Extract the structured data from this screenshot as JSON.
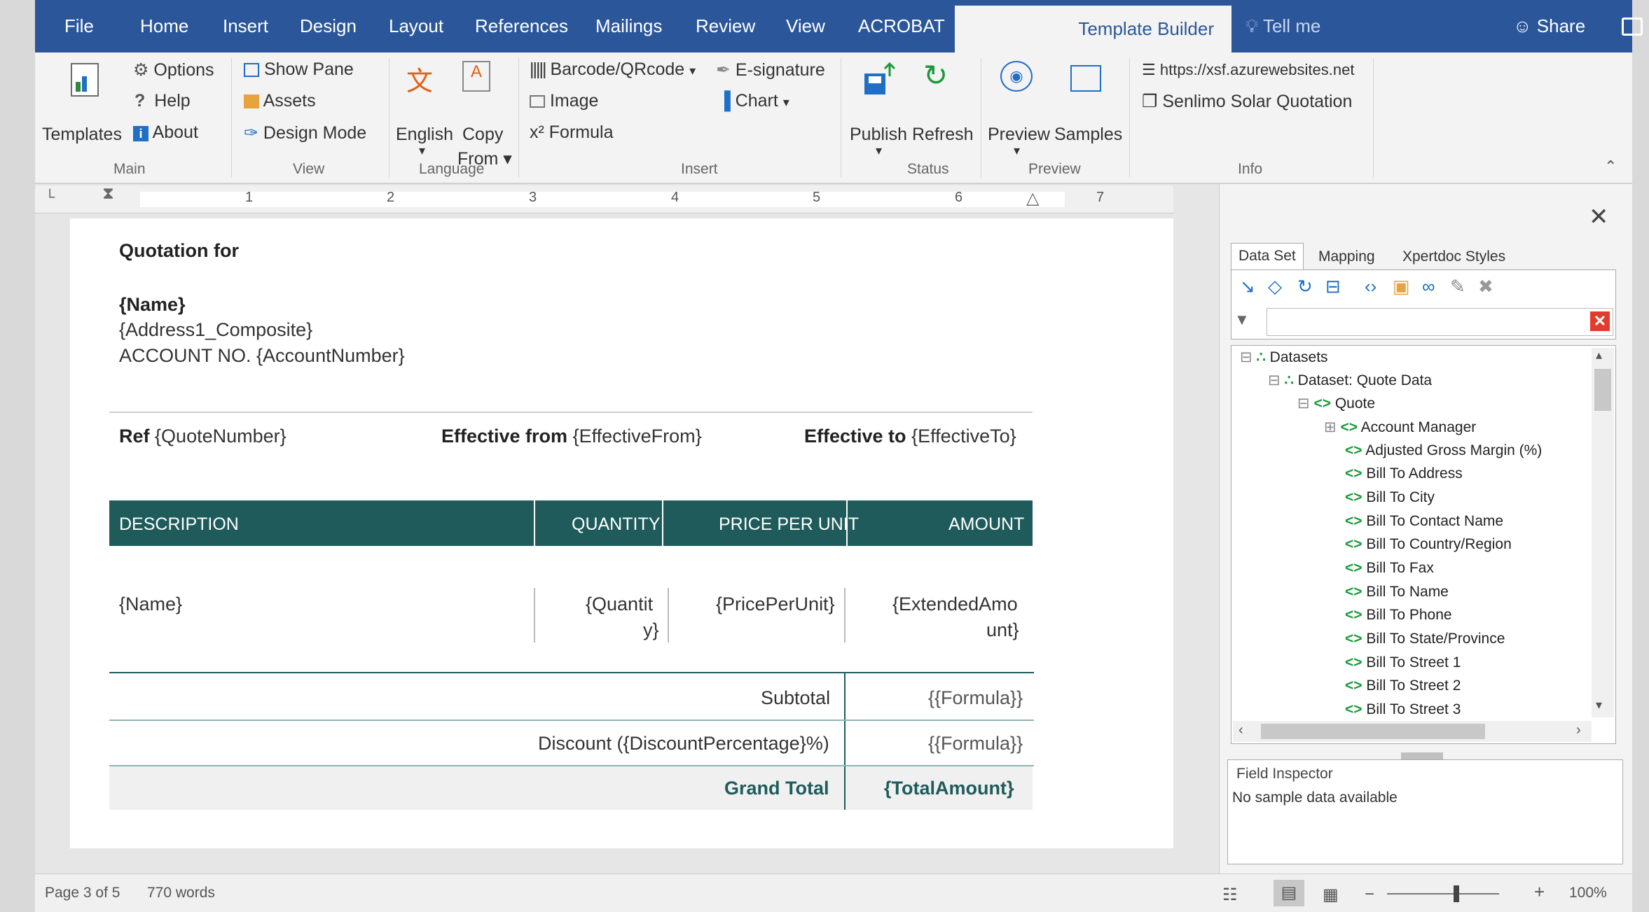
{
  "tabs": [
    {
      "label": "File"
    },
    {
      "label": "Home"
    },
    {
      "label": "Insert"
    },
    {
      "label": "Design"
    },
    {
      "label": "Layout"
    },
    {
      "label": "References"
    },
    {
      "label": "Mailings"
    },
    {
      "label": "Review"
    },
    {
      "label": "View"
    },
    {
      "label": "ACROBAT"
    },
    {
      "label": "Template Builder"
    }
  ],
  "tell_me": "Tell me",
  "share": "Share",
  "ribbon": {
    "main": {
      "templates": "Templates",
      "options": "Options",
      "help": "Help",
      "about": "About",
      "label": "Main"
    },
    "view": {
      "show_pane": "Show Pane",
      "assets": "Assets",
      "design_mode": "Design Mode",
      "label": "View"
    },
    "language": {
      "english": "English",
      "copy_from_1": "Copy",
      "copy_from_2": "From",
      "label": "Language"
    },
    "insert": {
      "barcode": "Barcode/QRcode",
      "image": "Image",
      "formula": "Formula",
      "esignature": "E-signature",
      "chart": "Chart",
      "label": "Insert"
    },
    "status": {
      "publish": "Publish",
      "refresh": "Refresh",
      "label": "Status"
    },
    "preview": {
      "preview": "Preview",
      "samples": "Samples",
      "label": "Preview"
    },
    "info": {
      "url": "https://xsf.azurewebsites.net",
      "quotation": "Senlimo Solar Quotation",
      "label": "Info"
    }
  },
  "ruler": {
    "numbers": [
      "1",
      "2",
      "3",
      "4",
      "5",
      "6",
      "7"
    ]
  },
  "document": {
    "heading": "Quotation for",
    "name": "{Name}",
    "address": "{Address1_Composite}",
    "account": "ACCOUNT NO. {AccountNumber}",
    "ref_label": "Ref",
    "ref_value": "{QuoteNumber}",
    "eff_from_label": "Effective from",
    "eff_from_value": "{EffectiveFrom}",
    "eff_to_label": "Effective to",
    "eff_to_value": "{EffectiveTo}",
    "table_headers": [
      "DESCRIPTION",
      "QUANTITY",
      "PRICE PER UNIT",
      "AMOUNT"
    ],
    "row_name": "{Name}",
    "row_qty_1": "{Quantit",
    "row_qty_2": "y}",
    "row_price": "{PricePerUnit}",
    "row_amount_1": "{ExtendedAmo",
    "row_amount_2": "unt}",
    "subtotal_label": "Subtotal",
    "subtotal_value": "{{Formula}}",
    "discount_label": "Discount ({DiscountPercentage}%)",
    "discount_value": "{{Formula}}",
    "grand_total_label": "Grand Total",
    "grand_total_value": "{TotalAmount}"
  },
  "panel": {
    "tabs": [
      "Data Set",
      "Mapping",
      "Xpertdoc Styles"
    ],
    "tree": [
      "Datasets",
      "Dataset: Quote Data",
      "Quote",
      "Account Manager",
      "Adjusted Gross Margin (%)",
      "Bill To Address",
      "Bill To City",
      "Bill To Contact Name",
      "Bill To Country/Region",
      "Bill To Fax",
      "Bill To Name",
      "Bill To Phone",
      "Bill To State/Province",
      "Bill To Street 1",
      "Bill To Street 2",
      "Bill To Street 3"
    ],
    "field_inspector": "Field Inspector",
    "no_sample": "No sample data available"
  },
  "status": {
    "page": "Page 3 of 5",
    "words": "770 words",
    "zoom": "100%"
  },
  "colors": {
    "accent": "#2b579a",
    "table_header": "#1f5b5b",
    "tree_green": "#1a9a3a"
  }
}
